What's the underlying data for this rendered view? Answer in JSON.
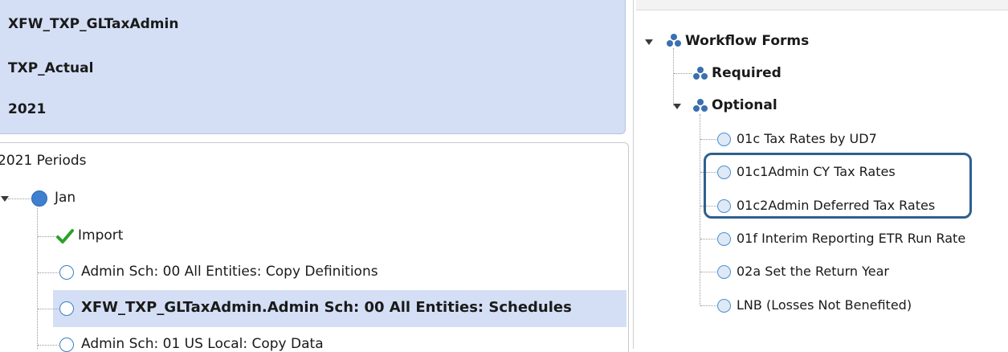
{
  "info": {
    "profile": "XFW_TXP_GLTaxAdmin",
    "scenario": "TXP_Actual",
    "year": "2021"
  },
  "periods": {
    "header": "2021 Periods",
    "month": "Jan",
    "steps": [
      {
        "label": "Import",
        "status": "complete"
      },
      {
        "label": "Admin Sch: 00 All Entities: Copy Definitions",
        "status": "pending"
      },
      {
        "label": "XFW_TXP_GLTaxAdmin.Admin Sch: 00 All Entities: Schedules",
        "status": "pending",
        "selected": true
      },
      {
        "label": "Admin Sch: 01 US Local: Copy Data",
        "status": "pending"
      }
    ]
  },
  "forms": {
    "root": "Workflow Forms",
    "required": "Required",
    "optional": "Optional",
    "items": [
      {
        "label": "01c Tax Rates by UD7"
      },
      {
        "label": "01c1Admin CY Tax Rates",
        "highlighted": true
      },
      {
        "label": "01c2Admin Deferred Tax Rates",
        "highlighted": true
      },
      {
        "label": "01f Interim Reporting ETR Run Rate"
      },
      {
        "label": "02a Set the Return Year"
      },
      {
        "label": "LNB (Losses Not Benefited)"
      }
    ]
  },
  "colors": {
    "info_bg": "#d4dff5",
    "selection_bg": "#d4dff5",
    "check_green": "#2aa12a",
    "circle_blue": "#3f7fcf",
    "highlight_border": "#2f5f8f"
  },
  "icons": {
    "group": "group-icon",
    "check": "check-icon",
    "status_circle": "circle-icon",
    "expand": "expand-triangle-icon"
  }
}
